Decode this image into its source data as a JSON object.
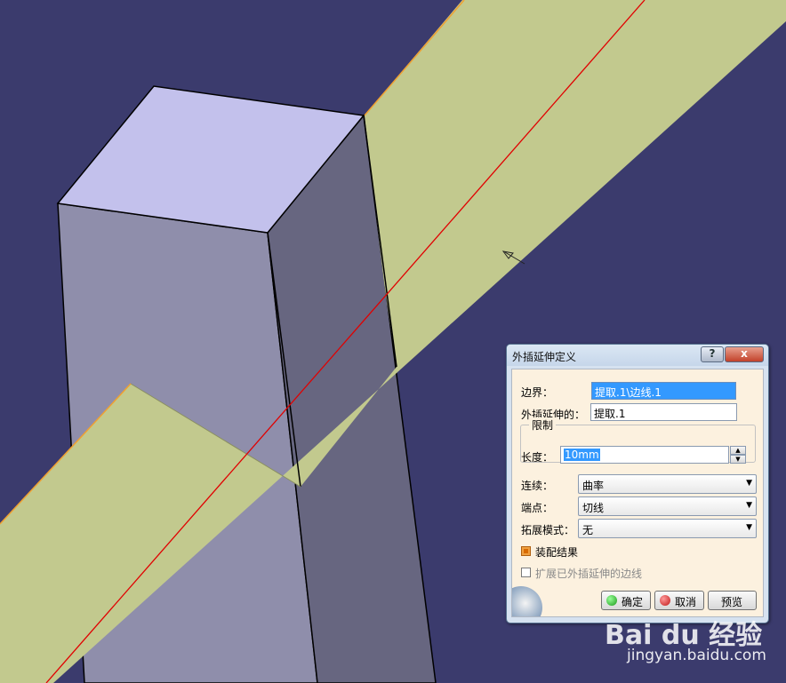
{
  "colors": {
    "background": "#3b3b6d",
    "surface": "#c2c98e",
    "box_top": "#c3c1ec",
    "box_front": "#8f8eab",
    "box_right": "#676680",
    "curve": "#e10000",
    "edge_orange": "#f0a030"
  },
  "dialog": {
    "title": "外插延伸定义",
    "help_icon": "?",
    "close_icon": "x",
    "boundary_label": "边界：",
    "boundary_value": "提取.1\\边线.1",
    "extrapolated_label": "外插延伸的：",
    "extrapolated_value": "提取.1",
    "limit_group": "限制",
    "length_label": "长度：",
    "length_value": "10mm",
    "continuity_label": "连续：",
    "continuity_value": "曲率",
    "endpoint_label": "端点：",
    "endpoint_value": "切线",
    "extend_mode_label": "拓展模式：",
    "extend_mode_value": "无",
    "assemble_label": "装配结果",
    "assemble_checked": true,
    "extend_edges_label": "扩展已外插延伸的边线",
    "extend_edges_checked": false,
    "ok_label": "确定",
    "cancel_label": "取消",
    "preview_label": "预览"
  },
  "watermark": {
    "logo": "Bai du 经验",
    "url": "jingyan.baidu.com"
  }
}
